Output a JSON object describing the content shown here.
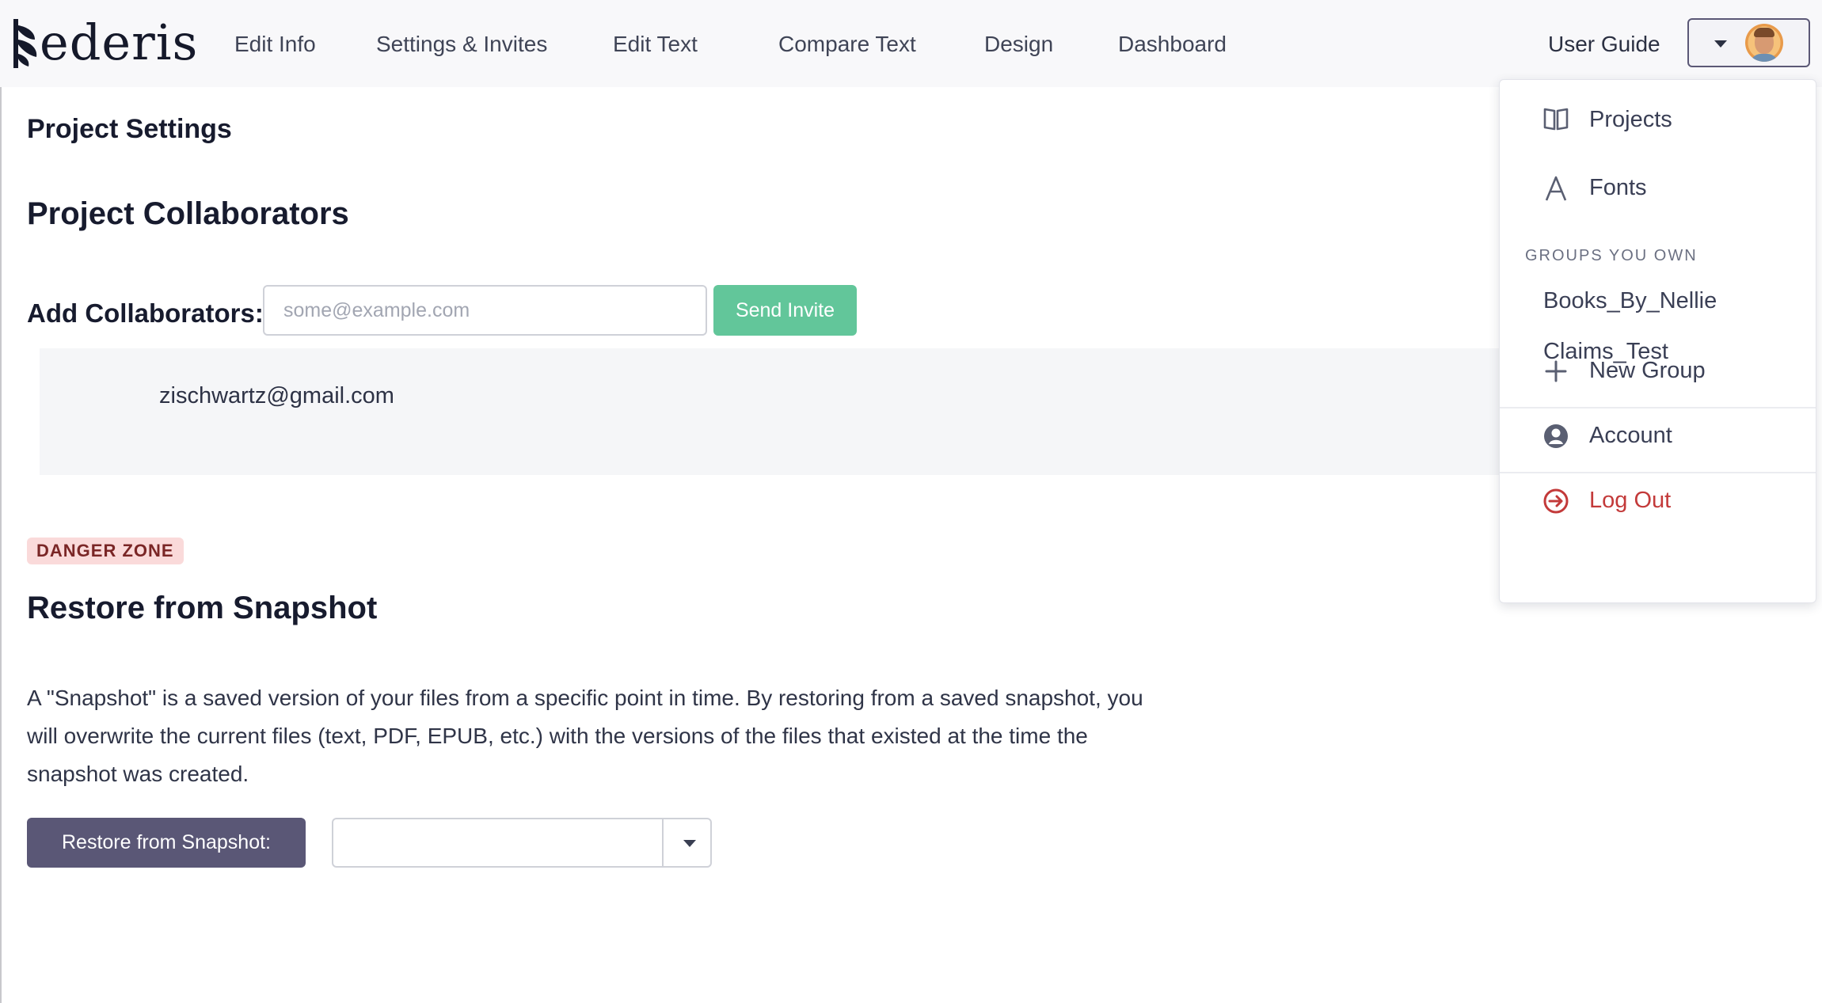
{
  "brand": {
    "name": "ederis"
  },
  "nav": {
    "items": [
      {
        "label": "Edit Info"
      },
      {
        "label": "Settings & Invites"
      },
      {
        "label": "Edit Text"
      },
      {
        "label": "Compare Text"
      },
      {
        "label": "Design"
      },
      {
        "label": "Dashboard"
      }
    ],
    "user_guide": "User Guide",
    "user_menu_icon": "chevron-down-icon"
  },
  "settings": {
    "page_title": "Project Settings",
    "collaborators_title": "Project Collaborators",
    "add_label": "Add Collaborators:",
    "email_placeholder": "some@example.com",
    "email_value": "",
    "send_button": "Send Invite",
    "collaborators": [
      "zischwartz@gmail.com"
    ]
  },
  "danger": {
    "badge": "DANGER ZONE",
    "restore_title": "Restore from Snapshot",
    "description": "A \"Snapshot\" is a saved version of your files from a specific point in time. By restoring from a saved snapshot, you will overwrite the current files (text, PDF, EPUB, etc.) with the versions of the files that existed at the time the snapshot was created.",
    "restore_button": "Restore from Snapshot:",
    "snapshot_selected": ""
  },
  "user_menu": {
    "items": [
      {
        "label": "Projects",
        "icon": "book-icon"
      },
      {
        "label": "Fonts",
        "icon": "font-icon"
      }
    ],
    "groups_heading": "GROUPS YOU OWN",
    "groups": [
      "Books_By_Nellie",
      "Claims_Test"
    ],
    "new_group": {
      "label": "New Group",
      "icon": "plus-icon"
    },
    "account": {
      "label": "Account",
      "icon": "user-circle-icon"
    },
    "logout": {
      "label": "Log Out",
      "icon": "logout-icon"
    }
  },
  "colors": {
    "accent_green": "#62c69a",
    "accent_purple": "#5a5776",
    "danger_red": "#c33a3a",
    "danger_badge_bg": "#fadada"
  }
}
